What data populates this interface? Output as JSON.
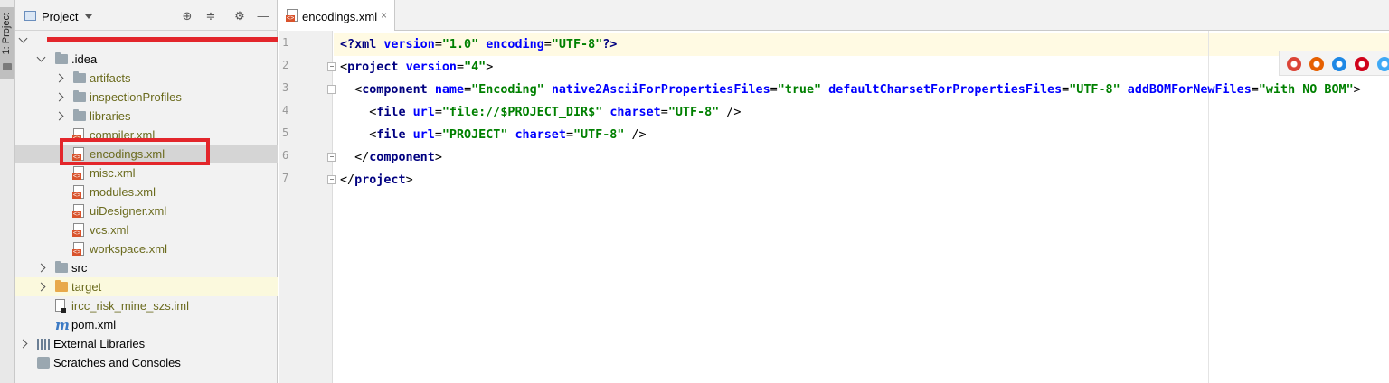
{
  "toolstrip": {
    "project_tab_label": "1: Project"
  },
  "panel": {
    "title": "Project",
    "tree": [
      {
        "label": "",
        "indent": 0,
        "arrow": "down",
        "icon": "none",
        "style": "",
        "redacted": true
      },
      {
        "label": ".idea",
        "indent": 1,
        "arrow": "down",
        "icon": "folder",
        "style": ""
      },
      {
        "label": "artifacts",
        "indent": 2,
        "arrow": "right",
        "icon": "folder",
        "style": "olive"
      },
      {
        "label": "inspectionProfiles",
        "indent": 2,
        "arrow": "right",
        "icon": "folder",
        "style": "olive"
      },
      {
        "label": "libraries",
        "indent": 2,
        "arrow": "right",
        "icon": "folder",
        "style": "olive"
      },
      {
        "label": "compiler.xml",
        "indent": 2,
        "arrow": "none",
        "icon": "xml",
        "style": "olive"
      },
      {
        "label": "encodings.xml",
        "indent": 2,
        "arrow": "none",
        "icon": "xml",
        "style": "olive",
        "selected": true
      },
      {
        "label": "misc.xml",
        "indent": 2,
        "arrow": "none",
        "icon": "xml",
        "style": "olive"
      },
      {
        "label": "modules.xml",
        "indent": 2,
        "arrow": "none",
        "icon": "xml",
        "style": "olive"
      },
      {
        "label": "uiDesigner.xml",
        "indent": 2,
        "arrow": "none",
        "icon": "xml",
        "style": "olive"
      },
      {
        "label": "vcs.xml",
        "indent": 2,
        "arrow": "none",
        "icon": "xml",
        "style": "olive"
      },
      {
        "label": "workspace.xml",
        "indent": 2,
        "arrow": "none",
        "icon": "xml",
        "style": "olive"
      },
      {
        "label": "src",
        "indent": 1,
        "arrow": "right",
        "icon": "folder",
        "style": ""
      },
      {
        "label": "target",
        "indent": 1,
        "arrow": "right",
        "icon": "folder-orange",
        "style": "olive",
        "highlight": true
      },
      {
        "label": "ircc_risk_mine_szs.iml",
        "indent": 1,
        "arrow": "none",
        "icon": "iml",
        "style": "olive"
      },
      {
        "label": "pom.xml",
        "indent": 1,
        "arrow": "none",
        "icon": "maven",
        "style": ""
      },
      {
        "label": "External Libraries",
        "indent": 0,
        "arrow": "right",
        "icon": "lib",
        "style": ""
      },
      {
        "label": "Scratches and Consoles",
        "indent": 0,
        "arrow": "none",
        "icon": "scratch",
        "style": ""
      }
    ]
  },
  "editor": {
    "tab_label": "encodings.xml",
    "tab_close": "×",
    "line_numbers": [
      "1",
      "2",
      "3",
      "4",
      "5",
      "6",
      "7"
    ],
    "code_lines": [
      [
        [
          "pi",
          "<?xml "
        ],
        [
          "attr",
          "version"
        ],
        [
          "p",
          "="
        ],
        [
          "val",
          "\"1.0\""
        ],
        [
          "p",
          " "
        ],
        [
          "attr",
          "encoding"
        ],
        [
          "p",
          "="
        ],
        [
          "val",
          "\"UTF-8\""
        ],
        [
          "pi",
          "?>"
        ]
      ],
      [
        [
          "p",
          "<"
        ],
        [
          "tag",
          "project"
        ],
        [
          "p",
          " "
        ],
        [
          "attr",
          "version"
        ],
        [
          "p",
          "="
        ],
        [
          "val",
          "\"4\""
        ],
        [
          "p",
          ">"
        ]
      ],
      [
        [
          "p",
          "  <"
        ],
        [
          "tag",
          "component"
        ],
        [
          "p",
          " "
        ],
        [
          "attr",
          "name"
        ],
        [
          "p",
          "="
        ],
        [
          "val",
          "\"Encoding\""
        ],
        [
          "p",
          " "
        ],
        [
          "attr",
          "native2AsciiForPropertiesFiles"
        ],
        [
          "p",
          "="
        ],
        [
          "val",
          "\"true\""
        ],
        [
          "p",
          " "
        ],
        [
          "attr",
          "defaultCharsetForPropertiesFiles"
        ],
        [
          "p",
          "="
        ],
        [
          "val",
          "\"UTF-8\""
        ],
        [
          "p",
          " "
        ],
        [
          "attr",
          "addBOMForNewFiles"
        ],
        [
          "p",
          "="
        ],
        [
          "val",
          "\"with NO BOM\""
        ],
        [
          "p",
          ">"
        ]
      ],
      [
        [
          "p",
          "    <"
        ],
        [
          "tag",
          "file"
        ],
        [
          "p",
          " "
        ],
        [
          "attr",
          "url"
        ],
        [
          "p",
          "="
        ],
        [
          "val",
          "\"file://$PROJECT_DIR$\""
        ],
        [
          "p",
          " "
        ],
        [
          "attr",
          "charset"
        ],
        [
          "p",
          "="
        ],
        [
          "val",
          "\"UTF-8\""
        ],
        [
          "p",
          " />"
        ]
      ],
      [
        [
          "p",
          "    <"
        ],
        [
          "tag",
          "file"
        ],
        [
          "p",
          " "
        ],
        [
          "attr",
          "url"
        ],
        [
          "p",
          "="
        ],
        [
          "val",
          "\"PROJECT\""
        ],
        [
          "p",
          " "
        ],
        [
          "attr",
          "charset"
        ],
        [
          "p",
          "="
        ],
        [
          "val",
          "\"UTF-8\""
        ],
        [
          "p",
          " />"
        ]
      ],
      [
        [
          "p",
          "  </"
        ],
        [
          "tag",
          "component"
        ],
        [
          "p",
          ">"
        ]
      ],
      [
        [
          "p",
          "</"
        ],
        [
          "tag",
          "project"
        ],
        [
          "p",
          ">"
        ]
      ]
    ]
  },
  "browsers": [
    {
      "name": "chrome-icon",
      "color": "#db4437"
    },
    {
      "name": "firefox-icon",
      "color": "#e66000"
    },
    {
      "name": "safari-icon",
      "color": "#1e88e5"
    },
    {
      "name": "opera-icon",
      "color": "#d0021b"
    },
    {
      "name": "ie-icon",
      "color": "#3fa9f5"
    }
  ]
}
